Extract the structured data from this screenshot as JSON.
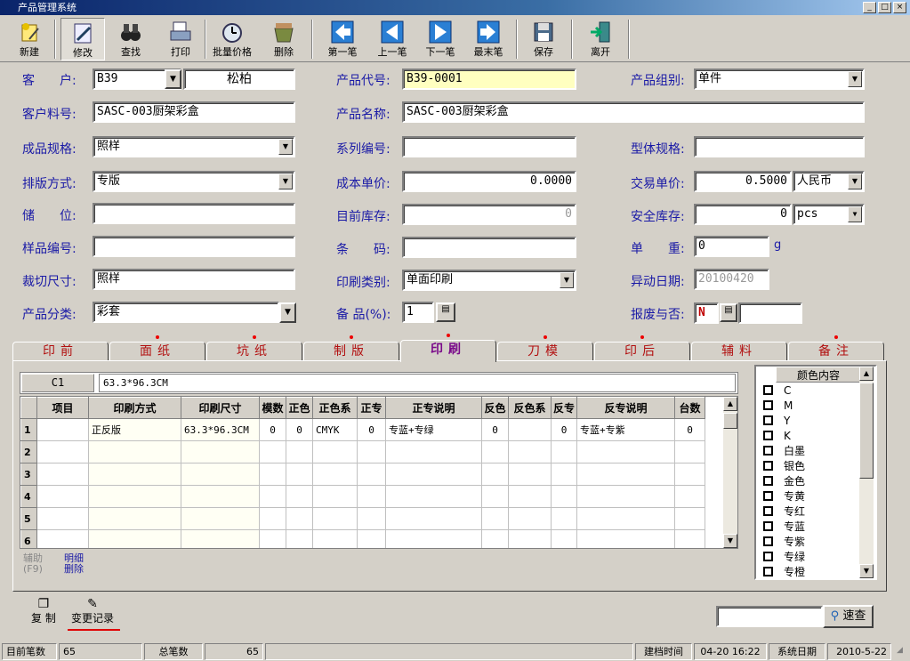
{
  "window": {
    "title": "产品管理系统",
    "min": "_",
    "max": "□",
    "close": "×"
  },
  "toolbar": [
    "新建",
    "修改",
    "查找",
    "打印",
    "批量价格",
    "删除",
    "第一笔",
    "上一笔",
    "下一笔",
    "最末笔",
    "保存",
    "离开"
  ],
  "form": {
    "customer_label": "客　　户:",
    "customer_code": "B39",
    "customer_name": "松柏",
    "product_code_label": "产品代号:",
    "product_code": "B39-0001",
    "product_group_label": "产品组别:",
    "product_group": "单件",
    "customer_part_label": "客户料号:",
    "customer_part": "SASC-003厨架彩盒",
    "product_name_label": "产品名称:",
    "product_name": "SASC-003厨架彩盒",
    "spec_label": "成品规格:",
    "spec": "照样",
    "series_label": "系列编号:",
    "series": "",
    "body_spec_label": "型体规格:",
    "body_spec": "",
    "layout_label": "排版方式:",
    "layout": "专版",
    "cost_label": "成本单价:",
    "cost": "0.0000",
    "trade_label": "交易单价:",
    "trade": "0.5000",
    "currency": "人民币",
    "storage_label": "储　　位:",
    "storage": "",
    "stock_label": "目前库存:",
    "stock": "0",
    "safety_label": "安全库存:",
    "safety": "0",
    "unit": "pcs",
    "sample_label": "样品编号:",
    "sample": "",
    "barcode_label": "条　　码:",
    "barcode": "",
    "weight_label": "单　　重:",
    "weight": "0",
    "weight_unit": "g",
    "cut_label": "裁切尺寸:",
    "cut": "照样",
    "print_type_label": "印刷类别:",
    "print_type": "单面印刷",
    "change_date_label": "异动日期:",
    "change_date": "20100420",
    "category_label": "产品分类:",
    "category": "彩套",
    "spare_label": "备 品(%):",
    "spare": "1",
    "scrap_label": "报废与否:",
    "scrap": "N"
  },
  "tabs": [
    "印前",
    "面纸",
    "坑纸",
    "制版",
    "印刷",
    "刀模",
    "印后",
    "辅料",
    "备注"
  ],
  "tab_dots": [
    false,
    true,
    true,
    true,
    true,
    true,
    true,
    false,
    true
  ],
  "print_tab": {
    "cell_ref": "C1",
    "cell_value": "63.3*96.3CM",
    "headers": [
      "项目",
      "印刷方式",
      "印刷尺寸",
      "模数",
      "正色",
      "正色系",
      "正专",
      "正专说明",
      "反色",
      "反色系",
      "反专",
      "反专说明",
      "台数"
    ],
    "rows": [
      [
        "1",
        "",
        "正反版",
        "63.3*96.3CM",
        "0",
        "0",
        "CMYK",
        "0",
        "专蓝+专绿",
        "0",
        "",
        "0",
        "专蓝+专紫",
        "0"
      ],
      [
        "2",
        "",
        "",
        "",
        "",
        "",
        "",
        "",
        "",
        "",
        "",
        "",
        "",
        ""
      ],
      [
        "3",
        "",
        "",
        "",
        "",
        "",
        "",
        "",
        "",
        "",
        "",
        "",
        "",
        ""
      ],
      [
        "4",
        "",
        "",
        "",
        "",
        "",
        "",
        "",
        "",
        "",
        "",
        "",
        "",
        ""
      ],
      [
        "5",
        "",
        "",
        "",
        "",
        "",
        "",
        "",
        "",
        "",
        "",
        "",
        "",
        ""
      ],
      [
        "6",
        "",
        "",
        "",
        "",
        "",
        "",
        "",
        "",
        "",
        "",
        "",
        "",
        ""
      ]
    ],
    "aux_label": "辅助\n(F9)",
    "detail_delete": "明细\n删除"
  },
  "colors": {
    "header": "颜色内容",
    "items": [
      "C",
      "M",
      "Y",
      "K",
      "白墨",
      "银色",
      "金色",
      "专黄",
      "专红",
      "专蓝",
      "专紫",
      "专绿",
      "专橙"
    ]
  },
  "bottom": {
    "copy": "复 制",
    "history": "变更记录",
    "search_placeholder": "",
    "search_btn": "速查"
  },
  "status": {
    "cur_label": "目前笔数",
    "cur": "65",
    "total_label": "总笔数",
    "total": "65",
    "create_label": "建档时间",
    "create": "04-20 16:22",
    "sys_label": "系统日期",
    "sys": "2010-5-22"
  }
}
